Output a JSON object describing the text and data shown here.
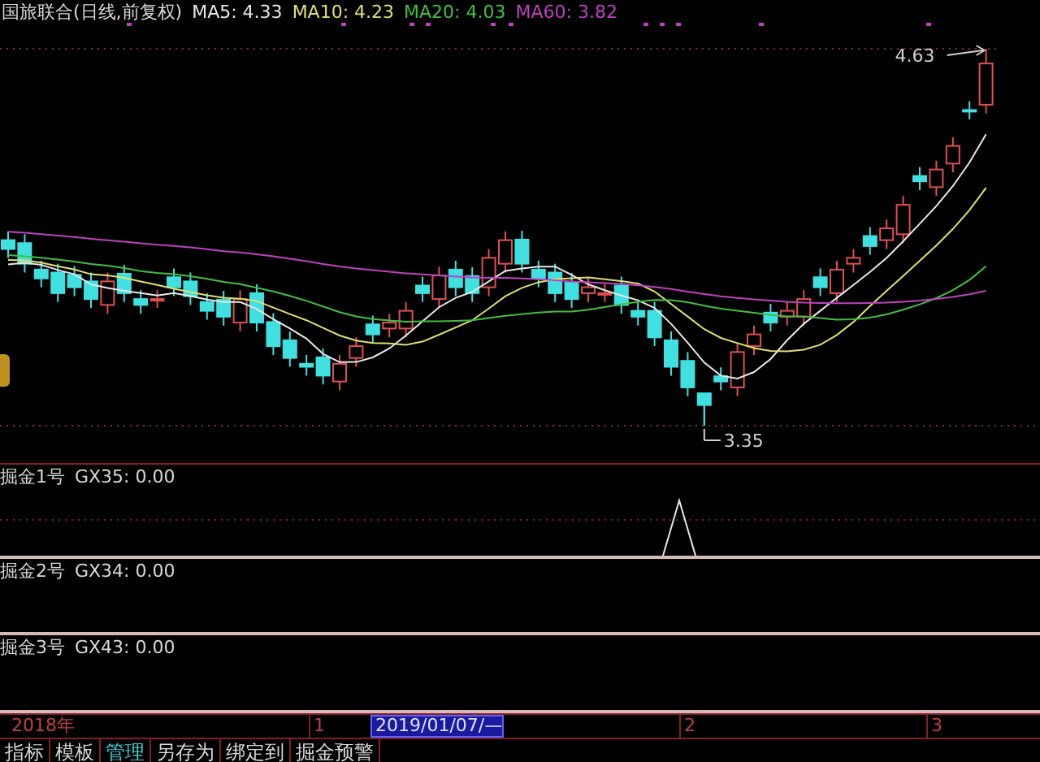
{
  "header": {
    "title": "国旅联合(日线,前复权)",
    "averages": [
      {
        "label": "MA5: 4.33",
        "color": "#e8e8e8"
      },
      {
        "label": "MA10: 4.23",
        "color": "#e0e070"
      },
      {
        "label": "MA20: 4.03",
        "color": "#40c040"
      },
      {
        "label": "MA60: 3.82",
        "color": "#c040c0"
      }
    ]
  },
  "chart": {
    "high_label": "4.63",
    "low_label": "3.35"
  },
  "panels": [
    {
      "name": "掘金1号",
      "reading": "GX35: 0.00"
    },
    {
      "name": "掘金2号",
      "reading": "GX34: 0.00"
    },
    {
      "name": "掘金3号",
      "reading": "GX43: 0.00"
    }
  ],
  "axis": [
    {
      "label": "2018年",
      "kind": "label"
    },
    {
      "label": "1",
      "kind": "label"
    },
    {
      "label": "2019/01/07/—",
      "kind": "cursor"
    },
    {
      "label": "2",
      "kind": "label"
    },
    {
      "label": "3",
      "kind": "label"
    }
  ],
  "tabs": [
    {
      "label": "指标",
      "selected": false
    },
    {
      "label": "模板",
      "selected": false
    },
    {
      "label": "管理",
      "selected": true
    },
    {
      "label": "另存为",
      "selected": false
    },
    {
      "label": "绑定到",
      "selected": false
    },
    {
      "label": "掘金预警",
      "selected": false
    }
  ]
}
